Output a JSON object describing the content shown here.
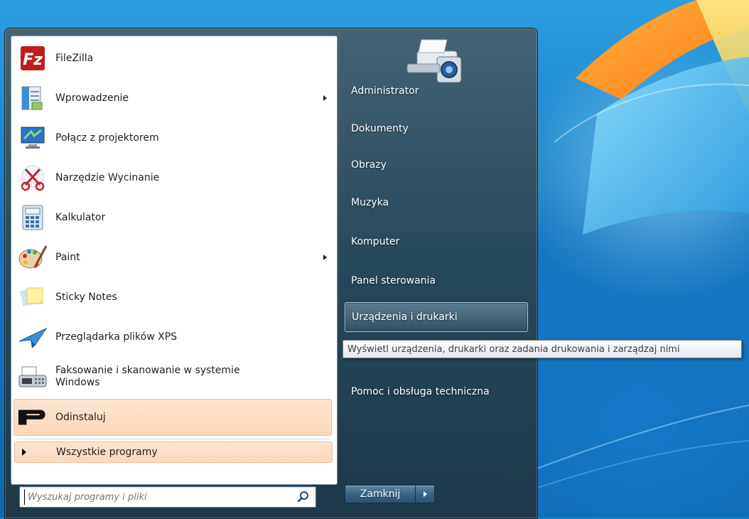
{
  "programs": [
    {
      "label": "FileZilla",
      "icon": "filezilla-icon",
      "has_submenu": false
    },
    {
      "label": "Wprowadzenie",
      "icon": "getting-started-icon",
      "has_submenu": true
    },
    {
      "label": "Połącz z projektorem",
      "icon": "projector-icon",
      "has_submenu": false
    },
    {
      "label": "Narzędzie Wycinanie",
      "icon": "snipping-tool-icon",
      "has_submenu": false
    },
    {
      "label": "Kalkulator",
      "icon": "calculator-icon",
      "has_submenu": false
    },
    {
      "label": "Paint",
      "icon": "paint-icon",
      "has_submenu": true
    },
    {
      "label": "Sticky Notes",
      "icon": "sticky-notes-icon",
      "has_submenu": false
    },
    {
      "label": "Przeglądarka plików XPS",
      "icon": "xps-viewer-icon",
      "has_submenu": false
    },
    {
      "label_line1": "Faksowanie i skanowanie w systemie",
      "label_line2": "Windows",
      "icon": "fax-scan-icon",
      "has_submenu": false
    },
    {
      "label": "Odinstaluj",
      "icon": "uninstall-icon",
      "has_submenu": false,
      "highlighted": true
    }
  ],
  "all_programs": {
    "label": "Wszystkie programy"
  },
  "search": {
    "placeholder": "Wyszukaj programy i pliki"
  },
  "right_pane": {
    "items": [
      {
        "label": "Administrator"
      },
      {
        "label": "Dokumenty"
      },
      {
        "label": "Obrazy"
      },
      {
        "label": "Muzyka"
      },
      {
        "label": "Komputer"
      },
      {
        "label": "Panel sterowania"
      },
      {
        "label": "Urządzenia i drukarki",
        "hovered": true
      },
      {
        "label": "Pomoc i obsługa techniczna"
      }
    ],
    "user_picture_icon": "devices-printers-icon"
  },
  "shutdown": {
    "label": "Zamknij"
  },
  "tooltip": {
    "text": "Wyświetl urządzenia, drukarki oraz zadania drukowania i zarządzaj nimi"
  },
  "colors": {
    "highlight": "#fcd8bc",
    "menu_frame": "#2e5568",
    "desktop": "#1a86c8"
  }
}
